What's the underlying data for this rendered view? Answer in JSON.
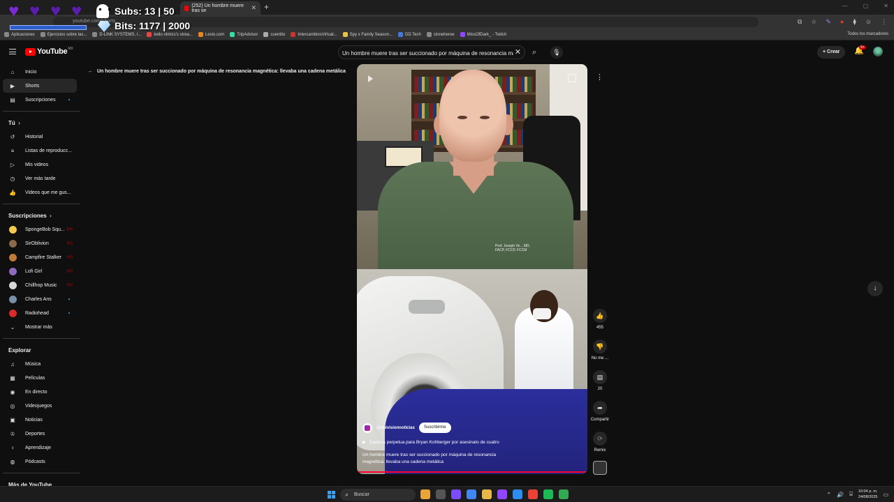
{
  "overlay": {
    "subs": "Subs: 13 | 50",
    "bits": "Bits: 1177 | 2000"
  },
  "browser": {
    "tab_title": "(252) Un hombre muere tras se",
    "address": "youtube.com/shorts",
    "bookmarks": [
      "Aplicaciones",
      "Ejercicios sobre las...",
      "D-LINK SYSTEMS, I...",
      "kelio ritmics's strea...",
      "Lexio.com",
      "TripAdvisor",
      "cuentito",
      "IntercambiosVirtual...",
      "Spy x Family Season...",
      "DD Tech",
      "cloneheroe",
      "MissOfDark_ - Twitch"
    ],
    "bookmarks_right": "Todos los marcadores"
  },
  "header": {
    "logo": "YouTube",
    "country": "MX",
    "search_value": "Un hombre muere tras ser succionado por máquina de resonancia ma",
    "create_label": "Crear",
    "notif_badge": "9+"
  },
  "sidebar": {
    "main": [
      {
        "label": "Inicio",
        "icon": "home-icon"
      },
      {
        "label": "Shorts",
        "icon": "shorts-icon"
      },
      {
        "label": "Suscripciones",
        "icon": "subscriptions-icon"
      }
    ],
    "you_header": "Tú",
    "you": [
      {
        "label": "Historial",
        "icon": "history-icon"
      },
      {
        "label": "Listas de reproducc...",
        "icon": "playlist-icon"
      },
      {
        "label": "Mis videos",
        "icon": "my-videos-icon"
      },
      {
        "label": "Ver más tarde",
        "icon": "watch-later-icon"
      },
      {
        "label": "Videos que me gus...",
        "icon": "liked-icon"
      }
    ],
    "subs_header": "Suscripciones",
    "subs": [
      {
        "label": "SpongeBob Squ...",
        "color": "#f2c94c"
      },
      {
        "label": "SirOblivion",
        "color": "#8a6a4a"
      },
      {
        "label": "Campfire Stalker",
        "color": "#c07a3a"
      },
      {
        "label": "Lofi Girl",
        "color": "#8e6bbf"
      },
      {
        "label": "Chillhop Music",
        "color": "#d8d8d8"
      },
      {
        "label": "Charles Ans",
        "color": "#7a8fa8"
      },
      {
        "label": "Radiohead",
        "color": "#d92b2b"
      }
    ],
    "show_more": "Mostrar más",
    "explore_header": "Explorar",
    "explore": [
      {
        "label": "Música",
        "icon": "music-icon"
      },
      {
        "label": "Películas",
        "icon": "movies-icon"
      },
      {
        "label": "En directo",
        "icon": "live-icon"
      },
      {
        "label": "Videojuegos",
        "icon": "gaming-icon"
      },
      {
        "label": "Noticias",
        "icon": "news-icon"
      },
      {
        "label": "Deportes",
        "icon": "sports-icon"
      },
      {
        "label": "Aprendizaje",
        "icon": "learning-icon"
      },
      {
        "label": "Pódcasts",
        "icon": "podcasts-icon"
      }
    ],
    "more_header": "Más de YouTube"
  },
  "short": {
    "title": "Un hombre muere tras ser succionado por máquina de resonancia magnética: llevaba una cadena metálica",
    "channel": "@univisionnoticias",
    "subscribe": "Suscribirme",
    "related": "Cadena perpetua para Bryan Kohberger por asesinato de cuatro",
    "caption": "Un hombre muere tras ser succionado por máquina de resonancia magnética: llevaba una cadena metálica",
    "embroidery": "Prof. Joseph Ve... MD, FACP, FCCP, FCCM",
    "progress": 0.99
  },
  "actions": {
    "likes": "455",
    "dislike": "No me ...",
    "comments": "20",
    "share": "Compartir",
    "remix": "Remix"
  },
  "taskbar": {
    "search": "Buscar",
    "time": "10:04 p. m.",
    "date": "24/08/2025"
  }
}
